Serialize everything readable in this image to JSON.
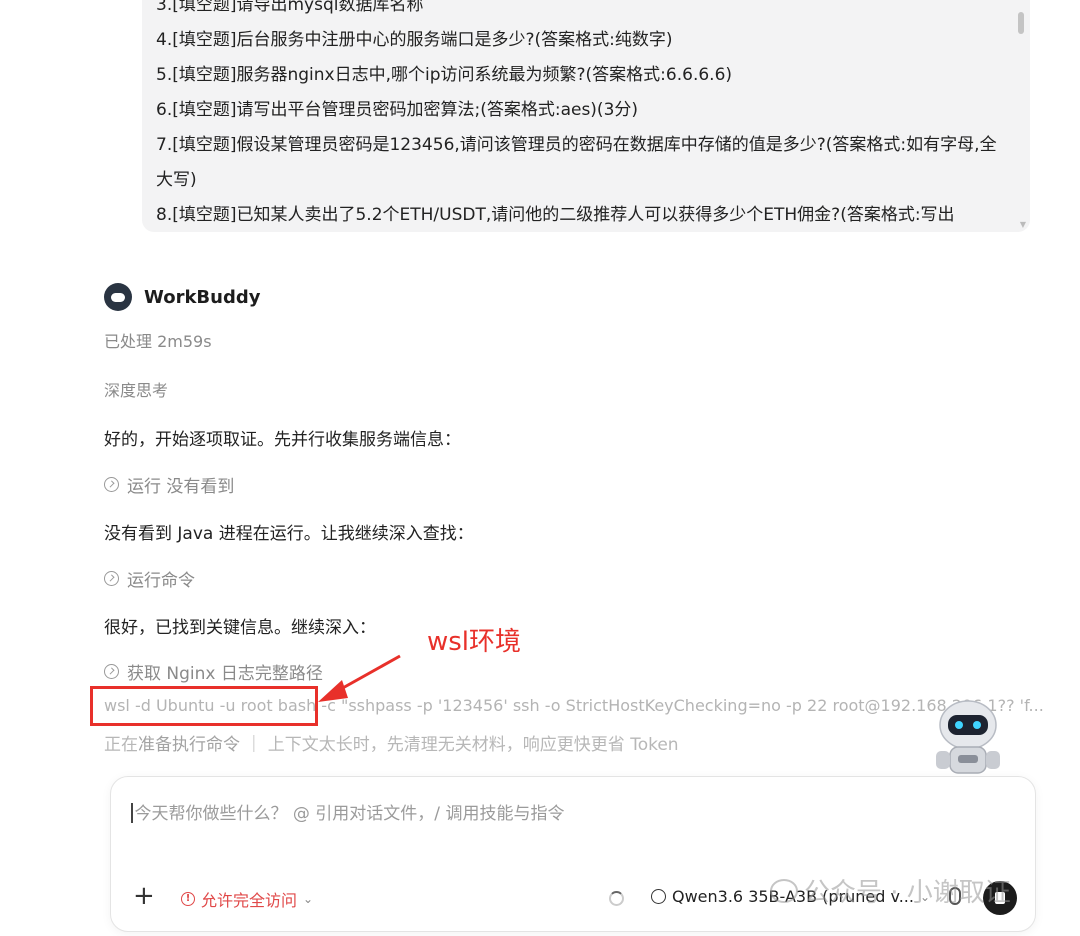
{
  "questions": [
    "3.[填空题]请导出mysql数据库名称",
    "4.[填空题]后台服务中注册中心的服务端口是多少?(答案格式:纯数字)",
    "5.[填空题]服务器nginx日志中,哪个ip访问系统最为频繁?(答案格式:6.6.6.6)",
    "6.[填空题]请写出平台管理员密码加密算法;(答案格式:aes)(3分)",
    "7.[填空题]假设某管理员密码是123456,请问该管理员的密码在数据库中存储的值是多少?(答案格式:如有字母,全大写)",
    "8.[填空题]已知某人卖出了5.2个ETH/USDT,请问他的二级推荐人可以获得多少个ETH佣金?(答案格式:写出"
  ],
  "agent": {
    "name": "WorkBuddy",
    "processed": "已处理 2m59s",
    "thinking": "深度思考",
    "msg1": "好的，开始逐项取证。先并行收集服务端信息：",
    "tool1": "运行 没有看到",
    "msg2": "没有看到 Java 进程在运行。让我继续深入查找：",
    "tool2": "运行命令",
    "msg3": "很好，已找到关键信息。继续深入：",
    "tool3": "获取 Nginx 日志完整路径",
    "command": "wsl -d Ubuntu -u root bash -c \"sshpass -p '123456' ssh -o StrictHostKeyChecking=no -p 22 root@192.168.206.1?? 'f...",
    "status_prefix": "正在",
    "status_bold": "准备执行命令",
    "status_rest": "｜ 上下文太长时，先清理无关材料，响应更快更省 Token"
  },
  "annotation": {
    "label": "wsl环境",
    "color": "#e8302a"
  },
  "input": {
    "placeholder": "今天帮你做些什么？ @ 引用对话文件，/ 调用技能与指令",
    "plus": "+",
    "access_label": "允许完全访问",
    "model_label": "Qwen3.6 35B-A3B (pruned v..."
  },
  "watermark": {
    "text": "公众号 · 小谢取证"
  },
  "icons": {
    "terminal": "terminal-icon",
    "warning": "warning-icon",
    "model": "model-icon",
    "mic": "mic-icon",
    "send": "send-icon"
  }
}
